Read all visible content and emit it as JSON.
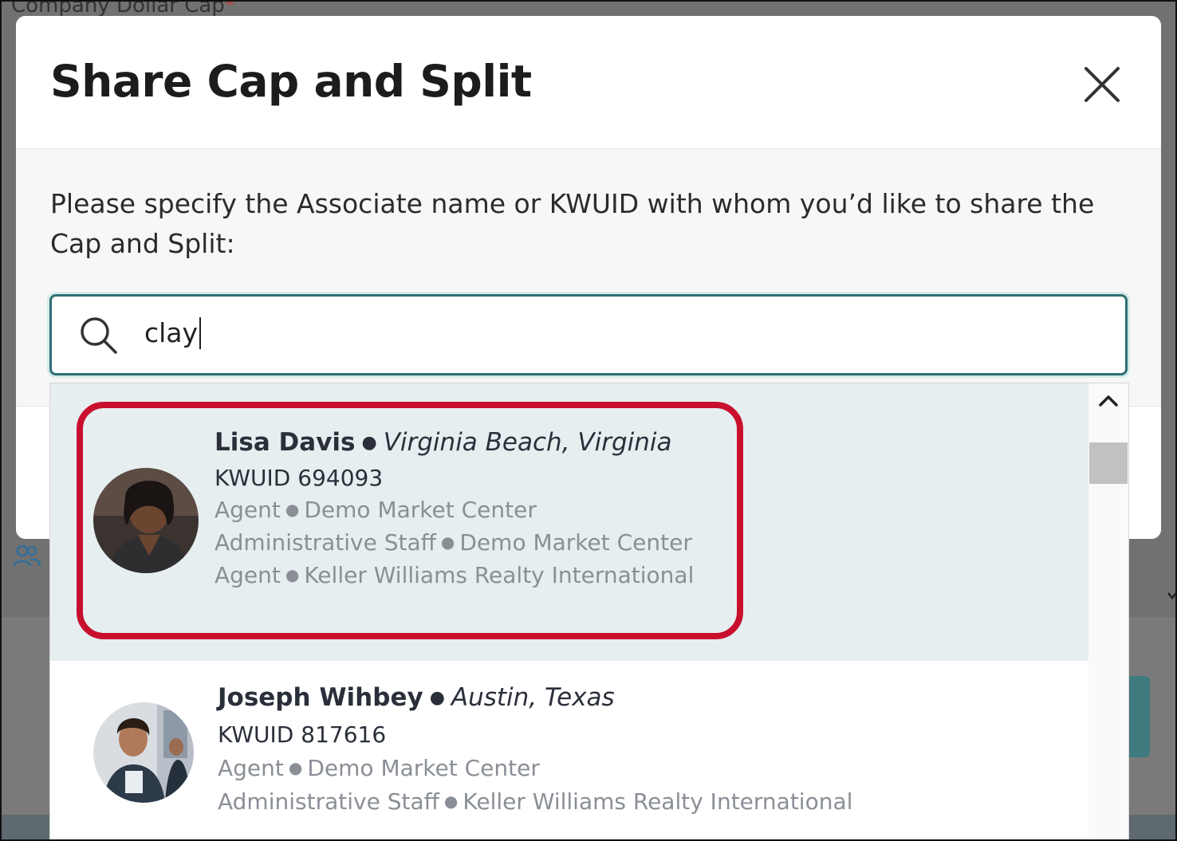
{
  "background": {
    "field_label": "Company Dollar Cap",
    "required_mark": "*"
  },
  "modal": {
    "title": "Share Cap and Split",
    "prompt": "Please specify the Associate name or KWUID with whom you’d like to share the Cap and Split:",
    "search": {
      "value": "clay"
    }
  },
  "results": [
    {
      "name": "Lisa Davis",
      "location": "Virginia Beach, Virginia",
      "kwuid": "KWUID 694093",
      "roles": [
        {
          "role": "Agent",
          "org": "Demo Market Center"
        },
        {
          "role": "Administrative Staff",
          "org": "Demo Market Center"
        },
        {
          "role": "Agent",
          "org": "Keller Williams Realty International"
        }
      ]
    },
    {
      "name": "Joseph Wihbey",
      "location": "Austin, Texas",
      "kwuid": "KWUID 817616",
      "roles": [
        {
          "role": "Agent",
          "org": "Demo Market Center"
        },
        {
          "role": "Administrative Staff",
          "org": "Keller Williams Realty International"
        }
      ]
    }
  ],
  "colors": {
    "accent": "#2f6f73",
    "highlight": "#c8102e",
    "active_row": "#e6eef0"
  },
  "icons": {
    "close": "close-icon",
    "search": "search-icon",
    "scroll_up": "chevron-up-icon",
    "people": "people-icon"
  }
}
